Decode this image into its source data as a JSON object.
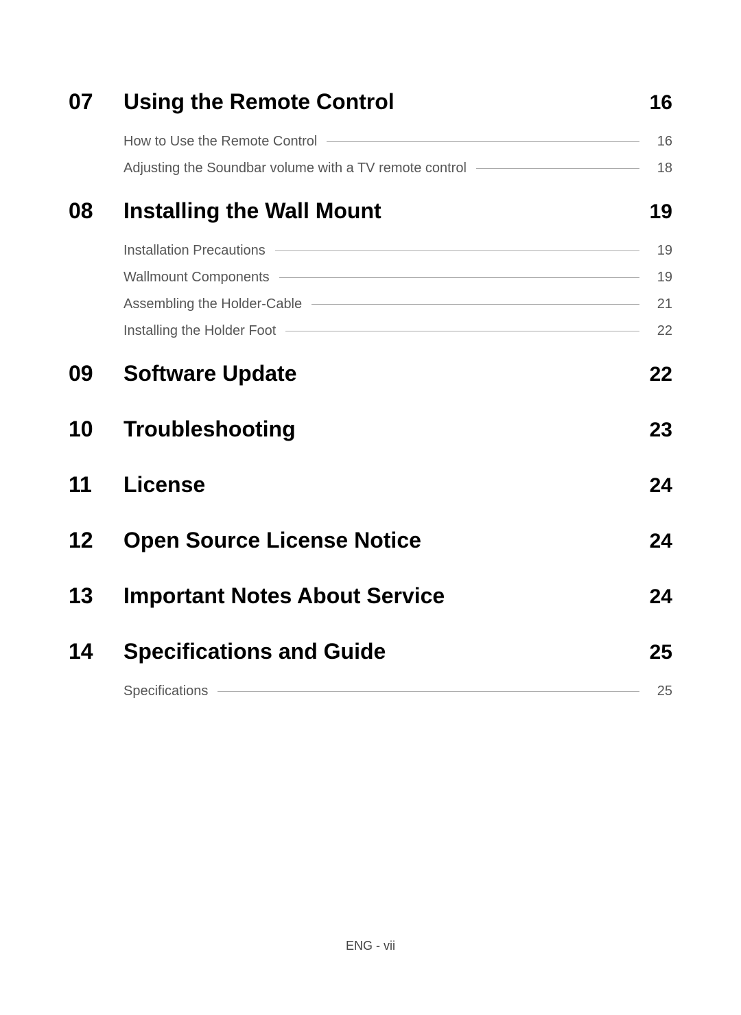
{
  "sections": [
    {
      "number": "07",
      "title": "Using the Remote Control",
      "page": "16",
      "subitems": [
        {
          "title": "How to Use the Remote Control",
          "page": "16"
        },
        {
          "title": "Adjusting the Soundbar volume with a TV remote control",
          "page": "18"
        }
      ]
    },
    {
      "number": "08",
      "title": "Installing the Wall Mount",
      "page": "19",
      "subitems": [
        {
          "title": "Installation Precautions",
          "page": "19"
        },
        {
          "title": "Wallmount Components",
          "page": "19"
        },
        {
          "title": "Assembling the Holder-Cable",
          "page": "21"
        },
        {
          "title": "Installing the Holder Foot",
          "page": "22"
        }
      ]
    },
    {
      "number": "09",
      "title": "Software Update",
      "page": "22",
      "subitems": []
    },
    {
      "number": "10",
      "title": "Troubleshooting",
      "page": "23",
      "subitems": []
    },
    {
      "number": "11",
      "title": "License",
      "page": "24",
      "subitems": []
    },
    {
      "number": "12",
      "title": "Open Source License Notice",
      "page": "24",
      "subitems": []
    },
    {
      "number": "13",
      "title": "Important Notes About Service",
      "page": "24",
      "subitems": []
    },
    {
      "number": "14",
      "title": "Specifications and Guide",
      "page": "25",
      "subitems": [
        {
          "title": "Specifications",
          "page": "25"
        }
      ]
    }
  ],
  "footer": "ENG - vii"
}
